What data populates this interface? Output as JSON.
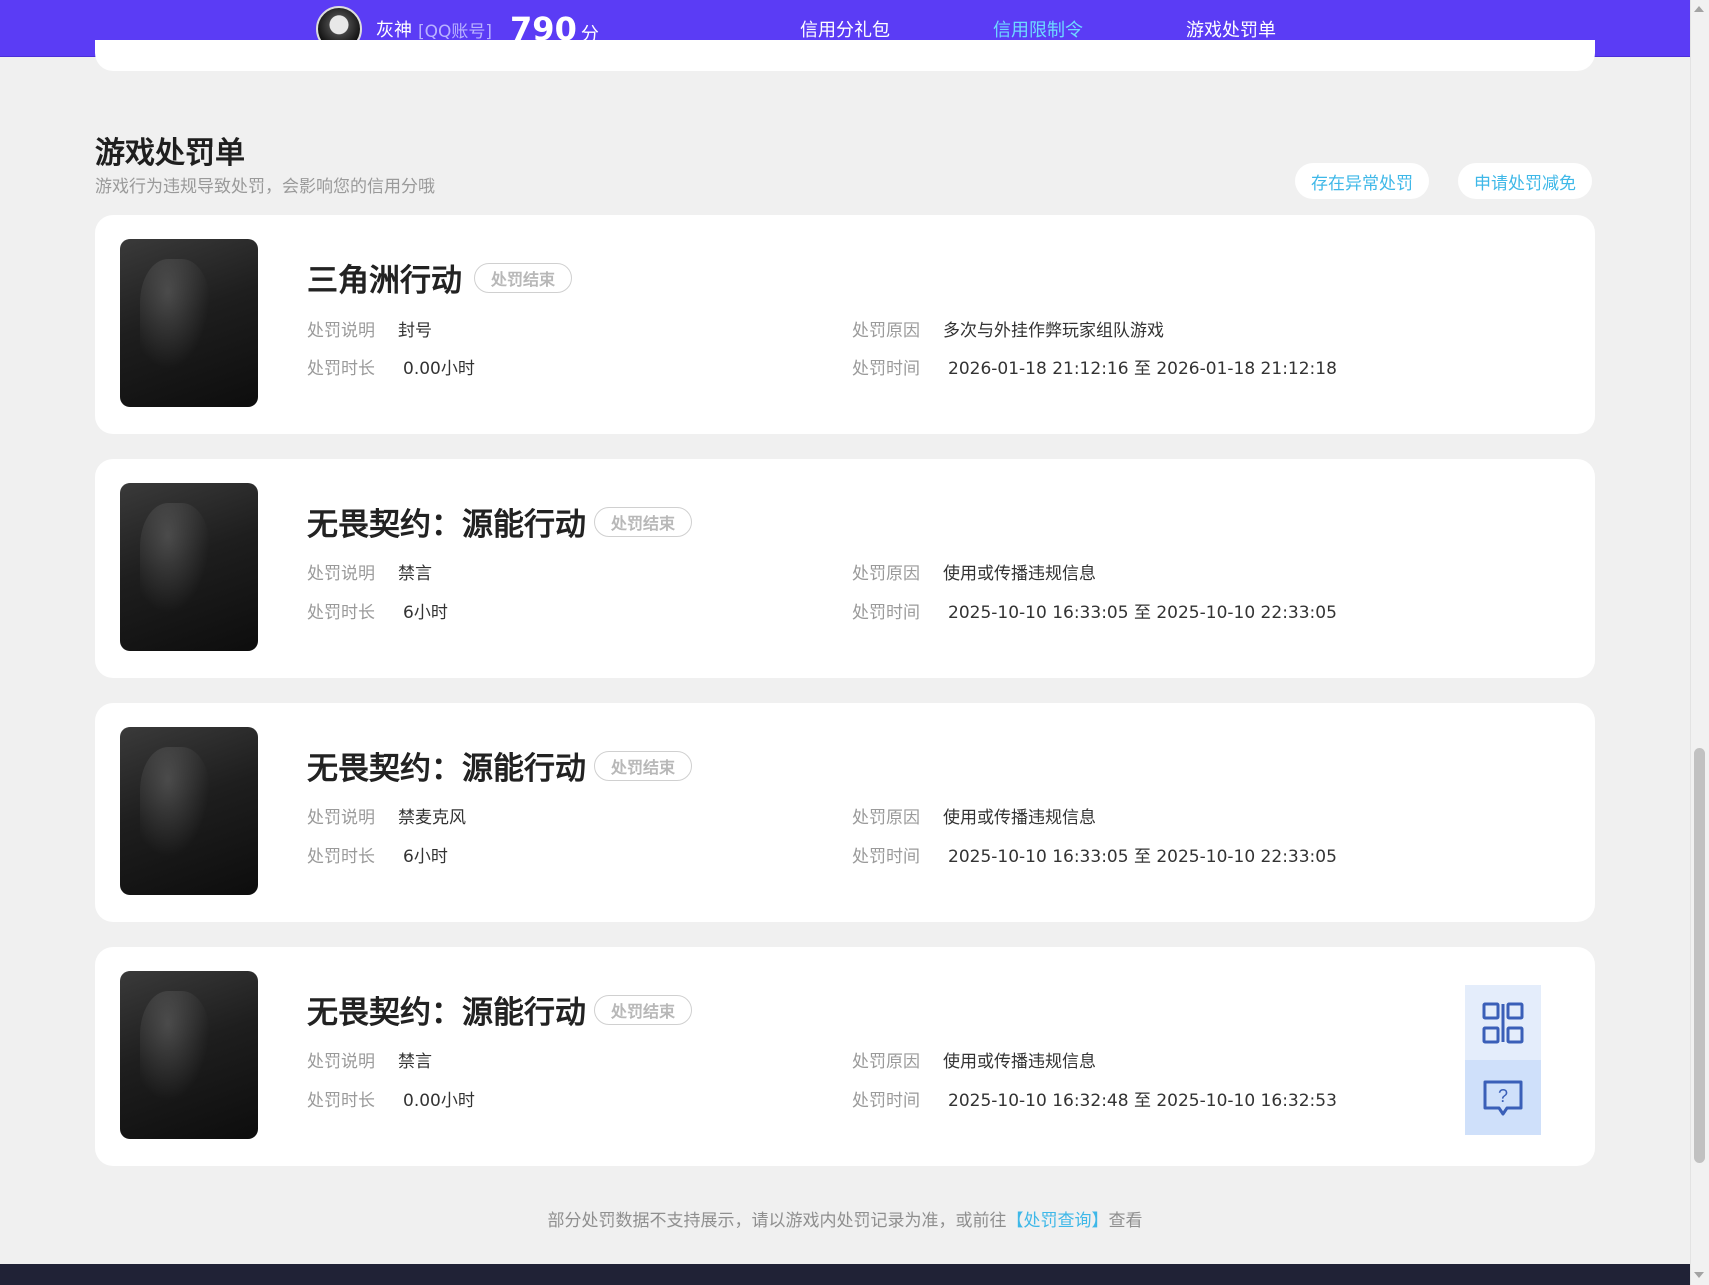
{
  "header": {
    "username": "灰神",
    "account_type": "[QQ账号]",
    "score": "790",
    "score_unit": "分",
    "nav": [
      {
        "label": "信用分礼包",
        "active": false
      },
      {
        "label": "信用限制令",
        "active": true
      },
      {
        "label": "游戏处罚单",
        "active": false
      }
    ]
  },
  "section": {
    "title": "游戏处罚单",
    "subtitle": "游戏行为违规导致处罚，会影响您的信用分哦",
    "actions": [
      "存在异常处罚",
      "申请处罚减免"
    ]
  },
  "labels": {
    "desc": "处罚说明",
    "duration": "处罚时长",
    "reason": "处罚原因",
    "time": "处罚时间"
  },
  "penalties": [
    {
      "game": "三角洲行动",
      "status": "处罚结束",
      "desc": "封号",
      "duration": "0.00小时",
      "reason": "多次与外挂作弊玩家组队游戏",
      "time": "2026-01-18 21:12:16 至 2026-01-18 21:12:18"
    },
    {
      "game": "无畏契约：源能行动",
      "status": "处罚结束",
      "desc": "禁言",
      "duration": "6小时",
      "reason": "使用或传播违规信息",
      "time": "2025-10-10 16:33:05 至 2025-10-10 22:33:05"
    },
    {
      "game": "无畏契约：源能行动",
      "status": "处罚结束",
      "desc": "禁麦克风",
      "duration": "6小时",
      "reason": "使用或传播违规信息",
      "time": "2025-10-10 16:33:05 至 2025-10-10 22:33:05"
    },
    {
      "game": "无畏契约：源能行动",
      "status": "处罚结束",
      "desc": "禁言",
      "duration": "0.00小时",
      "reason": "使用或传播违规信息",
      "time": "2025-10-10 16:32:48 至 2025-10-10 16:32:53"
    }
  ],
  "footer": {
    "text_before": "部分处罚数据不支持展示，请以游戏内处罚记录为准，或前往",
    "link": "【处罚查询】",
    "text_after": "查看"
  },
  "float_icons": [
    "qr-code-icon",
    "help-chat-icon"
  ],
  "colors": {
    "header_bg": "#5b3cf5",
    "accent": "#3fb8e8",
    "nav_active": "#6ed9ff"
  }
}
